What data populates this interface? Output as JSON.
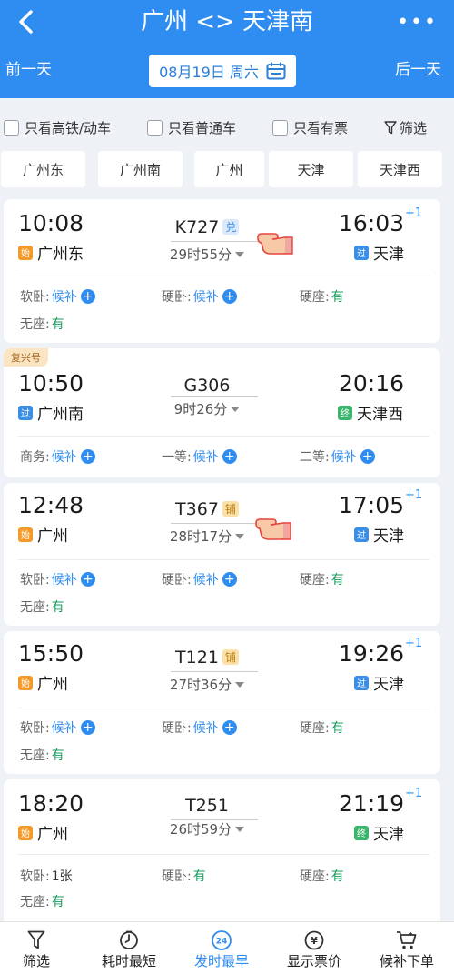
{
  "header": {
    "title": "广州 <> 天津南",
    "more": "•••",
    "prev_day": "前一天",
    "next_day": "后一天",
    "date": "08月19日 周六"
  },
  "filters": {
    "only_highspeed": "只看高铁/动车",
    "only_normal": "只看普通车",
    "only_available": "只看有票",
    "filter": "筛选"
  },
  "stations": [
    "广州东",
    "广州南",
    "广州",
    "天津",
    "天津西"
  ],
  "trains": [
    {
      "dep_time": "10:08",
      "dep_station": "广州东",
      "dep_badge": "始",
      "train_no": "K727",
      "tag": "兑",
      "duration": "29时55分",
      "arr_time": "16:03",
      "plus": "+1",
      "arr_station": "天津",
      "arr_badge": "过",
      "seats": [
        {
          "label": "软卧:",
          "value": "候补"
        },
        {
          "label": "硬卧:",
          "value": "候补"
        },
        {
          "label": "硬座:",
          "value": "有"
        },
        {
          "label": "无座:",
          "value": "有"
        }
      ]
    },
    {
      "badge": "复兴号",
      "dep_time": "10:50",
      "dep_station": "广州南",
      "dep_badge": "过",
      "train_no": "G306",
      "duration": "9时26分",
      "arr_time": "20:16",
      "arr_station": "天津西",
      "arr_badge": "终",
      "seats": [
        {
          "label": "商务:",
          "value": "候补"
        },
        {
          "label": "一等:",
          "value": "候补"
        },
        {
          "label": "二等:",
          "value": "候补"
        }
      ]
    },
    {
      "dep_time": "12:48",
      "dep_station": "广州",
      "dep_badge": "始",
      "train_no": "T367",
      "tag": "铺",
      "duration": "28时17分",
      "arr_time": "17:05",
      "plus": "+1",
      "arr_station": "天津",
      "arr_badge": "过",
      "seats": [
        {
          "label": "软卧:",
          "value": "候补"
        },
        {
          "label": "硬卧:",
          "value": "候补"
        },
        {
          "label": "硬座:",
          "value": "有"
        },
        {
          "label": "无座:",
          "value": "有"
        }
      ]
    },
    {
      "dep_time": "15:50",
      "dep_station": "广州",
      "dep_badge": "始",
      "train_no": "T121",
      "tag": "铺",
      "duration": "27时36分",
      "arr_time": "19:26",
      "plus": "+1",
      "arr_station": "天津",
      "arr_badge": "过",
      "seats": [
        {
          "label": "软卧:",
          "value": "候补"
        },
        {
          "label": "硬卧:",
          "value": "候补"
        },
        {
          "label": "硬座:",
          "value": "有"
        },
        {
          "label": "无座:",
          "value": "有"
        }
      ]
    },
    {
      "dep_time": "18:20",
      "dep_station": "广州",
      "dep_badge": "始",
      "train_no": "T251",
      "duration": "26时59分",
      "arr_time": "21:19",
      "plus": "+1",
      "arr_station": "天津",
      "arr_badge": "终",
      "seats": [
        {
          "label": "软卧:",
          "value": "1张"
        },
        {
          "label": "硬卧:",
          "value": "有"
        },
        {
          "label": "硬座:",
          "value": "有"
        },
        {
          "label": "无座:",
          "value": "有"
        }
      ]
    }
  ],
  "tabbar": [
    {
      "label": "筛选",
      "icon": "filter-icon"
    },
    {
      "label": "耗时最短",
      "icon": "timer-icon"
    },
    {
      "label": "发时最早",
      "icon": "clock-24-icon",
      "active": true,
      "icon_text": "24"
    },
    {
      "label": "显示票价",
      "icon": "yuan-icon",
      "icon_text": "¥"
    },
    {
      "label": "候补下单",
      "icon": "cart-icon"
    }
  ],
  "colors": {
    "brand": "#2f8cf0",
    "available": "#1a9b5d"
  }
}
